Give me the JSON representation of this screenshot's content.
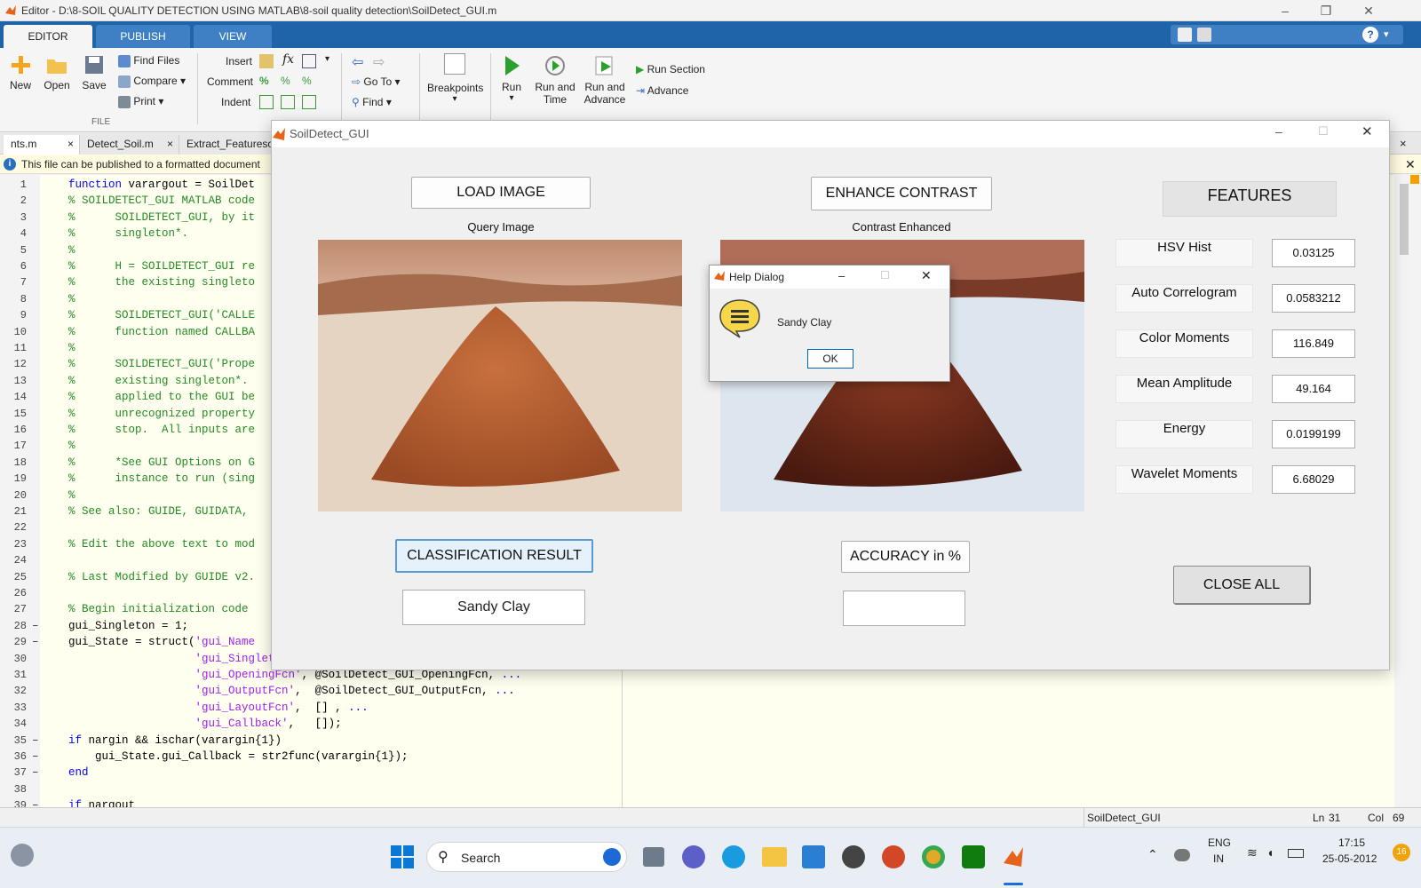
{
  "editor": {
    "title": "Editor - D:\\8-SOIL QUALITY DETECTION USING MATLAB\\8-soil quality detection\\SoilDetect_GUI.m",
    "ribbon_tabs": [
      "EDITOR",
      "PUBLISH",
      "VIEW"
    ],
    "file_group": {
      "new": "New",
      "open": "Open",
      "save": "Save",
      "find_files": "Find Files",
      "compare": "Compare",
      "print": "Print",
      "group_label": "FILE"
    },
    "edit_group": {
      "insert": "Insert",
      "comment": "Comment",
      "indent": "Indent",
      "fx": "fx"
    },
    "nav_group": {
      "goto": "Go To",
      "find": "Find"
    },
    "breakpoints": "Breakpoints",
    "run_group": {
      "run": "Run",
      "run_time_1": "Run and",
      "run_time_2": "Time",
      "run_adv_1": "Run and",
      "run_adv_2": "Advance",
      "run_section": "Run Section",
      "advance": "Advance"
    },
    "file_tabs": [
      "nts.m",
      "Detect_Soil.m",
      "Extract_Featureso"
    ],
    "info_bar": "This file can be published to a formatted document",
    "status": {
      "file": "SoilDetect_GUI",
      "ln_label": "Ln",
      "ln": "31",
      "col_label": "Col",
      "col": "69"
    }
  },
  "code_lines": [
    {
      "n": "1",
      "dash": "",
      "html": "<span class='kw'>function</span> varargout = SoilDet"
    },
    {
      "n": "2",
      "dash": "",
      "html": "<span class='cm'>% SOILDETECT_GUI MATLAB code</span>"
    },
    {
      "n": "3",
      "dash": "",
      "html": "<span class='cm'>%      SOILDETECT_GUI, by it</span>"
    },
    {
      "n": "4",
      "dash": "",
      "html": "<span class='cm'>%      singleton*.</span>"
    },
    {
      "n": "5",
      "dash": "",
      "html": "<span class='cm'>%</span>"
    },
    {
      "n": "6",
      "dash": "",
      "html": "<span class='cm'>%      H = SOILDETECT_GUI re</span>"
    },
    {
      "n": "7",
      "dash": "",
      "html": "<span class='cm'>%      the existing singleto</span>"
    },
    {
      "n": "8",
      "dash": "",
      "html": "<span class='cm'>%</span>"
    },
    {
      "n": "9",
      "dash": "",
      "html": "<span class='cm'>%      SOILDETECT_GUI('CALLE</span>"
    },
    {
      "n": "10",
      "dash": "",
      "html": "<span class='cm'>%      function named CALLBA</span>"
    },
    {
      "n": "11",
      "dash": "",
      "html": "<span class='cm'>%</span>"
    },
    {
      "n": "12",
      "dash": "",
      "html": "<span class='cm'>%      SOILDETECT_GUI('Prope</span>"
    },
    {
      "n": "13",
      "dash": "",
      "html": "<span class='cm'>%      existing singleton*.</span>"
    },
    {
      "n": "14",
      "dash": "",
      "html": "<span class='cm'>%      applied to the GUI be</span>"
    },
    {
      "n": "15",
      "dash": "",
      "html": "<span class='cm'>%      unrecognized property</span>"
    },
    {
      "n": "16",
      "dash": "",
      "html": "<span class='cm'>%      stop.  All inputs are</span>"
    },
    {
      "n": "17",
      "dash": "",
      "html": "<span class='cm'>%</span>"
    },
    {
      "n": "18",
      "dash": "",
      "html": "<span class='cm'>%      *See GUI Options on G</span>"
    },
    {
      "n": "19",
      "dash": "",
      "html": "<span class='cm'>%      instance to run (sing</span>"
    },
    {
      "n": "20",
      "dash": "",
      "html": "<span class='cm'>%</span>"
    },
    {
      "n": "21",
      "dash": "",
      "html": "<span class='cm'>% See also: GUIDE, GUIDATA,</span>"
    },
    {
      "n": "22",
      "dash": "",
      "html": ""
    },
    {
      "n": "23",
      "dash": "",
      "html": "<span class='cm'>% Edit the above text to mod</span>"
    },
    {
      "n": "24",
      "dash": "",
      "html": ""
    },
    {
      "n": "25",
      "dash": "",
      "html": "<span class='cm'>% Last Modified by GUIDE v2.</span>"
    },
    {
      "n": "26",
      "dash": "",
      "html": ""
    },
    {
      "n": "27",
      "dash": "",
      "html": "<span class='cm'>% Begin initialization code</span>"
    },
    {
      "n": "28",
      "dash": "–",
      "html": "gui_Singleton = 1;"
    },
    {
      "n": "29",
      "dash": "–",
      "html": "gui_State = struct(<span class='st'>'gui_Name</span>"
    },
    {
      "n": "30",
      "dash": "",
      "html": "                   <span class='st'>'gui_Singleton'</span>,  gui_Singleton, <span class='kw'>...</span>"
    },
    {
      "n": "31",
      "dash": "",
      "html": "                   <span class='st'>'gui_OpeningFcn'</span>, @SoilDetect_GUI_OpeningFcn, <span class='kw'>...</span>"
    },
    {
      "n": "32",
      "dash": "",
      "html": "                   <span class='st'>'gui_OutputFcn'</span>,  @SoilDetect_GUI_OutputFcn, <span class='kw'>...</span>"
    },
    {
      "n": "33",
      "dash": "",
      "html": "                   <span class='st'>'gui_LayoutFcn'</span>,  [] , <span class='kw'>...</span>"
    },
    {
      "n": "34",
      "dash": "",
      "html": "                   <span class='st'>'gui_Callback'</span>,   []);"
    },
    {
      "n": "35",
      "dash": "–",
      "html": "<span class='kw'>if</span> nargin &amp;&amp; ischar(varargin{1})"
    },
    {
      "n": "36",
      "dash": "–",
      "html": "    gui_State.gui_Callback = str2func(varargin{1});"
    },
    {
      "n": "37",
      "dash": "–",
      "html": "<span class='kw'>end</span>"
    },
    {
      "n": "38",
      "dash": "",
      "html": ""
    },
    {
      "n": "39",
      "dash": "–",
      "html": "<span class='kw'>if</span> nargout"
    }
  ],
  "gui": {
    "title": "SoilDetect_GUI",
    "load_image": "LOAD IMAGE",
    "query_image_label": "Query Image",
    "enhance_contrast": "ENHANCE CONTRAST",
    "contrast_label": "Contrast Enhanced",
    "features_title": "FEATURES",
    "features": [
      {
        "name": "HSV Hist",
        "value": "0.03125"
      },
      {
        "name": "Auto Correlogram",
        "value": "0.0583212"
      },
      {
        "name": "Color Moments",
        "value": "116.849"
      },
      {
        "name": "Mean Amplitude",
        "value": "49.164"
      },
      {
        "name": "Energy",
        "value": "0.0199199"
      },
      {
        "name": "Wavelet Moments",
        "value": "6.68029"
      }
    ],
    "classification_button": "CLASSIFICATION RESULT",
    "classification_value": "Sandy Clay",
    "accuracy_button": "ACCURACY in %",
    "accuracy_value": "",
    "close_all": "CLOSE ALL"
  },
  "help_dialog": {
    "title": "Help Dialog",
    "message": "Sandy Clay",
    "ok": "OK"
  },
  "taskbar": {
    "search": "Search",
    "lang_1": "ENG",
    "lang_2": "IN",
    "time": "17:15",
    "date": "25-05-2012",
    "badge": "16"
  },
  "colors": {
    "ribbon_blue": "#1f63a8",
    "code_bg": "#fffff0",
    "comment": "#228b22",
    "keyword": "#0000ff",
    "string": "#a020f0"
  }
}
